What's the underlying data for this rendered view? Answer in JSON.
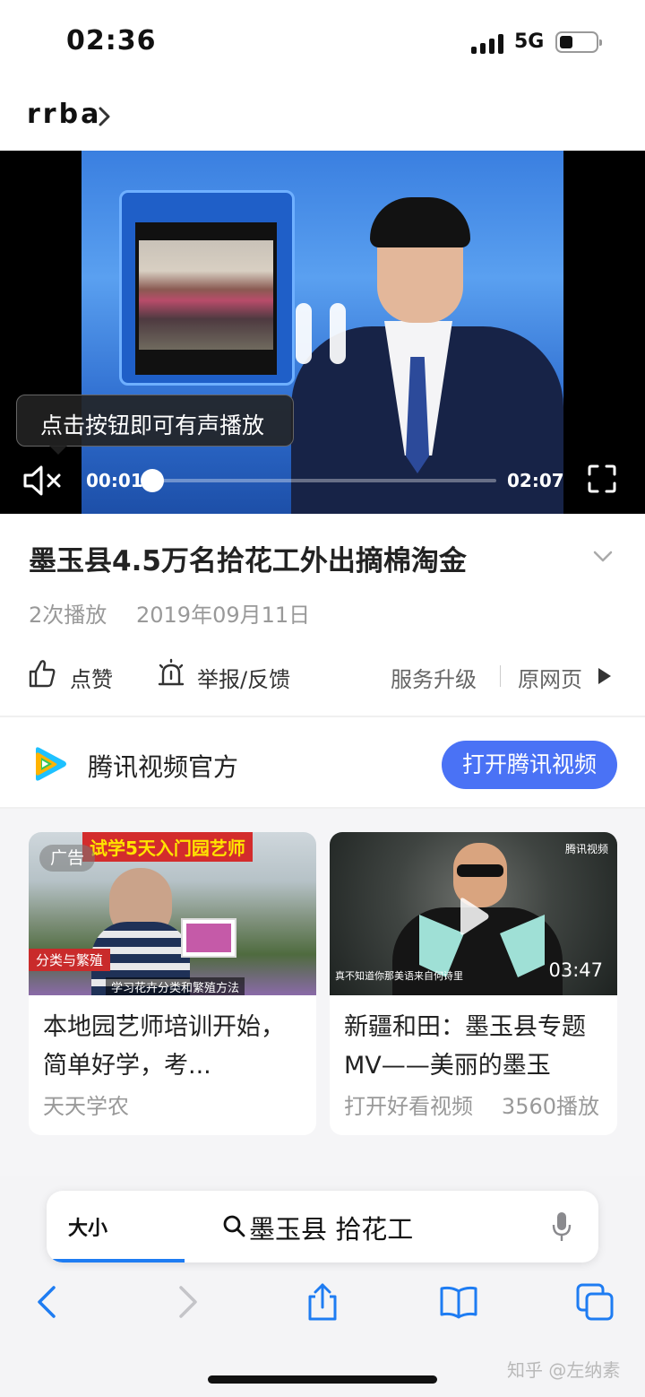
{
  "status_bar": {
    "time": "02:36",
    "network": "5G",
    "battery_level": 0.35,
    "icons": [
      "signal-icon",
      "battery-icon"
    ]
  },
  "site": {
    "name": "rrba"
  },
  "video": {
    "tooltip": "点击按钮即可有声播放",
    "current_time": "00:01",
    "total_time": "02:07",
    "progress": 0.008,
    "icons": [
      "pause-icon",
      "mute-icon",
      "fullscreen-icon"
    ]
  },
  "info": {
    "title": "墨玉县4.5万名拾花工外出摘棉淘金",
    "plays": "2次播放",
    "date": "2019年09月11日"
  },
  "actions": {
    "like": "点赞",
    "report": "举报/反馈",
    "upgrade": "服务升级",
    "original": "原网页"
  },
  "channel": {
    "name": "腾讯视频官方",
    "button": "打开腾讯视频",
    "accent": "#4a72f5"
  },
  "recommendations": [
    {
      "badge": "广告",
      "thumb_banner": "试学5天入门园艺师",
      "thumb_tag": "分类与繁殖",
      "thumb_caption": "学习花卉分类和繁殖方法",
      "title": "本地园艺师培训开始，简单好学，考...",
      "source": "天天学农"
    },
    {
      "watermark": "腾讯视频",
      "thumb_subtitle": "真不知道你那美语来自何诗里",
      "duration": "03:47",
      "title": "新疆和田：墨玉县专题MV——美丽的墨玉",
      "source": "打开好看视频",
      "plays": "3560播放"
    }
  ],
  "browser": {
    "text_size": "大小",
    "address": "墨玉县 拾花工",
    "load_progress": 0.25,
    "accent": "#1e7cf2"
  },
  "watermark": "知乎 @左纳素"
}
